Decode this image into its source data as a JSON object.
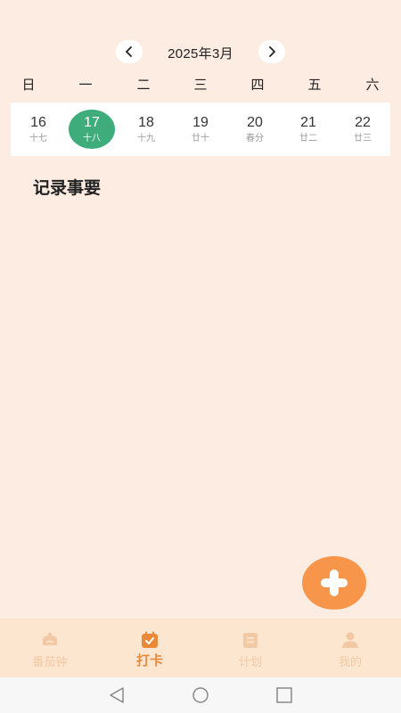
{
  "header": {
    "month_title": "2025年3月",
    "prev_icon": "chevron-left-icon",
    "next_icon": "chevron-right-icon"
  },
  "weekdays": [
    "日",
    "一",
    "二",
    "三",
    "四",
    "五",
    "六"
  ],
  "week": {
    "days": [
      {
        "num": "16",
        "lunar": "十七"
      },
      {
        "num": "17",
        "lunar": "十八",
        "selected": true
      },
      {
        "num": "18",
        "lunar": "十九"
      },
      {
        "num": "19",
        "lunar": "廿十"
      },
      {
        "num": "20",
        "lunar": "春分"
      },
      {
        "num": "21",
        "lunar": "廿二"
      },
      {
        "num": "22",
        "lunar": "廿三"
      }
    ]
  },
  "section": {
    "title": "记录事要"
  },
  "fab": {
    "icon": "plus-icon"
  },
  "tabbar": {
    "items": [
      {
        "label": "番茄钟",
        "icon": "timer-icon",
        "active": false
      },
      {
        "label": "打卡",
        "icon": "calendar-check-icon",
        "active": true
      },
      {
        "label": "计划",
        "icon": "list-icon",
        "active": false
      },
      {
        "label": "我的",
        "icon": "user-icon",
        "active": false
      }
    ]
  },
  "colors": {
    "background": "#fdece2",
    "selected_day": "#3fac7c",
    "accent": "#f7954a",
    "tab_active": "#e88a3a",
    "tab_inactive": "#f2c9a5"
  }
}
